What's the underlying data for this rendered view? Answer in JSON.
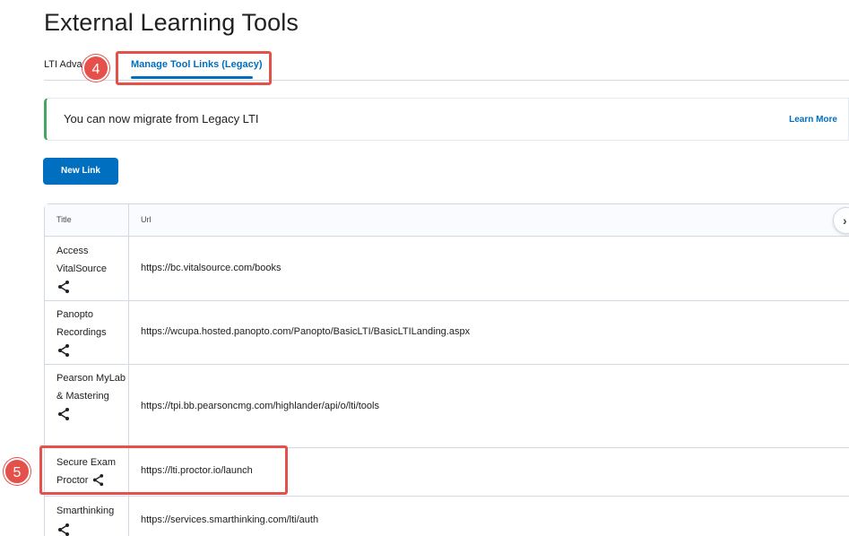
{
  "page": {
    "title": "External Learning Tools"
  },
  "tabs": [
    {
      "label": "LTI Advantage"
    },
    {
      "label": "Manage Tool Links (Legacy)"
    }
  ],
  "callouts": {
    "step4": "4",
    "step5": "5"
  },
  "alert": {
    "message": "You can now migrate from Legacy LTI",
    "link": "Learn More"
  },
  "new_link_button": "New Link",
  "table": {
    "headers": {
      "title": "Title",
      "url": "Url"
    },
    "rows": [
      {
        "title": "Access VitalSource",
        "url": "https://bc.vitalsource.com/books"
      },
      {
        "title": "Panopto Recordings",
        "url": "https://wcupa.hosted.panopto.com/Panopto/BasicLTI/BasicLTILanding.aspx"
      },
      {
        "title": "Pearson MyLab & Mastering",
        "url": "https://tpi.bb.pearsoncmg.com/highlander/api/o/lti/tools"
      },
      {
        "title": "Secure Exam Proctor",
        "url": "https://lti.proctor.io/launch"
      },
      {
        "title": "Smarthinking",
        "url": "https://services.smarthinking.com/lti/auth"
      }
    ]
  },
  "icons": {
    "share": "share-icon",
    "scroll": "chevron-right-icon"
  },
  "colors": {
    "accent": "#006fbf",
    "callout": "#e6504a",
    "alert_bar": "#46a661"
  }
}
